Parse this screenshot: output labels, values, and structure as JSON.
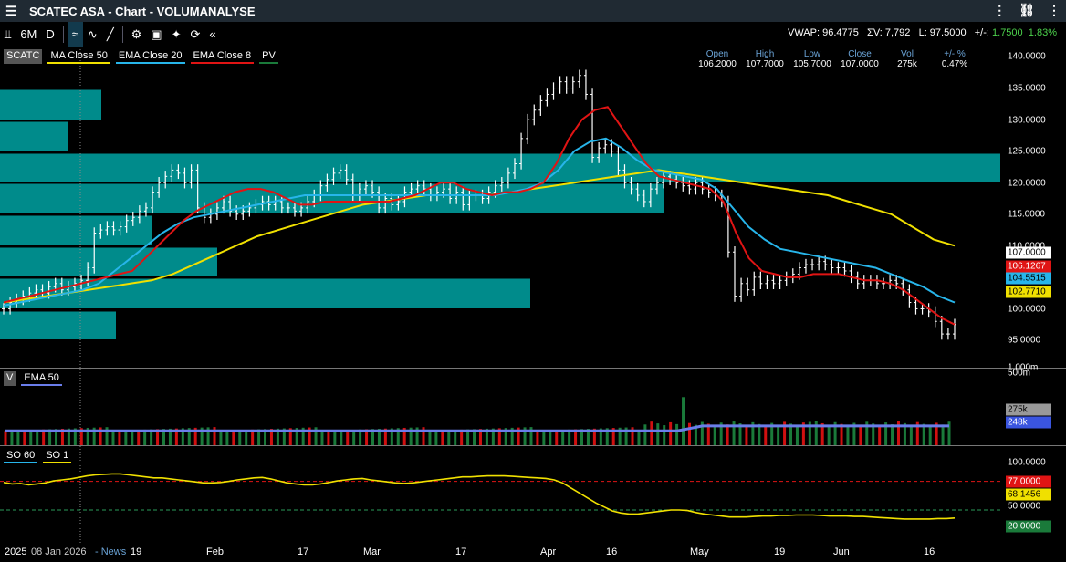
{
  "window": {
    "title": "SCATEC ASA - Chart - VOLUMANALYSE"
  },
  "toolbar": {
    "period": "6M",
    "interval": "D",
    "collapse": "«"
  },
  "quote": {
    "vwap": "VWAP: 96.4775",
    "volume": "ΣV: 7,792",
    "last": "L: 97.5000",
    "change_label": "+/-:",
    "change": "1.7500",
    "change_pct": "1.83%"
  },
  "legend": {
    "symbol": "SCATC",
    "ma50": "MA Close 50",
    "ema20": "EMA Close 20",
    "ema8": "EMA Close 8",
    "pv": "PV"
  },
  "ohlc": {
    "headers": [
      "Open",
      "High",
      "Low",
      "Close",
      "Vol",
      "+/- %"
    ],
    "values": [
      "106.2000",
      "107.7000",
      "105.7000",
      "107.0000",
      "275k",
      "0.47%"
    ]
  },
  "price_axis": {
    "ticks": [
      "140.0000",
      "135.0000",
      "130.0000",
      "125.0000",
      "120.0000",
      "115.0000",
      "110.0000",
      "100.0000",
      "95.0000"
    ],
    "tags": [
      {
        "label": "107.0000",
        "bg": "#ffffff",
        "fg": "#000000"
      },
      {
        "label": "106.1267",
        "bg": "#e01414",
        "fg": "#ffffff"
      },
      {
        "label": "104.5515",
        "bg": "#27b5ea",
        "fg": "#000000"
      },
      {
        "label": "102.7710",
        "bg": "#f0e000",
        "fg": "#000000"
      }
    ]
  },
  "volume_pane": {
    "legend_v": "V",
    "legend_ema": "EMA 50",
    "axis_top": "1.000m",
    "axis_mid": "500m",
    "tag_last": "275k",
    "tag_ema": "248k"
  },
  "so_pane": {
    "legend_60": "SO 60",
    "legend_1": "SO 1",
    "axis_100": "100.0000",
    "axis_50": "50.0000",
    "tag_77": "77.0000",
    "tag_68": "68.1456",
    "tag_20": "20.0000"
  },
  "xaxis": {
    "labels": [
      "2025",
      "08 Jan 2026",
      "- News",
      "19",
      "Feb",
      "17",
      "Mar",
      "17",
      "Apr",
      "16",
      "May",
      "19",
      "Jun",
      "16"
    ]
  },
  "colors": {
    "ema8": "#e01414",
    "ema20": "#27b5ea",
    "ma50": "#f0e000",
    "vp": "#008b8b",
    "vol_up": "#1a7a3a",
    "vol_down": "#d01010",
    "vol_ema": "#6a7dea"
  },
  "chart_data": {
    "type": "line",
    "price_closes": [
      100,
      101,
      101.5,
      102,
      102.5,
      103,
      102.5,
      103.5,
      104,
      103,
      103.5,
      104,
      104.5,
      106.5,
      112,
      112.5,
      113,
      112.5,
      113,
      114,
      114.5,
      115.5,
      116,
      118.5,
      120,
      121,
      122,
      121.5,
      120,
      122,
      116,
      114.5,
      115,
      116,
      117,
      115.5,
      115,
      115.5,
      116,
      116.5,
      117,
      116.5,
      117,
      116,
      116,
      115.5,
      116,
      117,
      118,
      119.5,
      120.5,
      121.5,
      122,
      120.5,
      118,
      119,
      119.5,
      118.5,
      116,
      117.5,
      116.5,
      117,
      118.5,
      119,
      119.5,
      119,
      118,
      118.5,
      119,
      117.5,
      118.5,
      116.5,
      118,
      118,
      117.5,
      118.5,
      119.5,
      120,
      121.5,
      123,
      127,
      130,
      131.5,
      133,
      134,
      135,
      136,
      135,
      136,
      137,
      134,
      124,
      125.5,
      126,
      125,
      122,
      120,
      119,
      118,
      117,
      119,
      120,
      121,
      120.5,
      120,
      119.5,
      119,
      120,
      119,
      118.5,
      118,
      117,
      109,
      102,
      104,
      103,
      105,
      104,
      104.5,
      104,
      104.5,
      105,
      105.5,
      106.5,
      107,
      107,
      107.5,
      107,
      106.5,
      106.5,
      106,
      105,
      104,
      104.5,
      104.5,
      104,
      104,
      104.5,
      104,
      103,
      101,
      100,
      100,
      99.5,
      98,
      96,
      96,
      97.5
    ],
    "ema8": [
      101,
      101.5,
      102,
      102.5,
      103,
      103.5,
      104,
      104.5,
      105,
      105.5,
      106,
      108,
      110,
      112,
      114,
      115.5,
      116.5,
      117.5,
      118.5,
      119,
      119,
      118.5,
      117.5,
      116.5,
      116.5,
      117,
      117,
      117,
      117,
      117,
      117,
      117.5,
      118,
      119,
      120,
      120,
      119,
      118.5,
      118,
      118.5,
      118.5,
      119,
      120,
      123,
      127,
      130,
      131.5,
      132,
      129,
      126,
      123,
      121,
      120.5,
      120,
      119.5,
      119,
      117,
      112,
      108,
      106,
      105.5,
      105,
      105,
      105.5,
      105.5,
      105.5,
      105,
      104.5,
      104.5,
      104,
      103,
      101.5,
      100,
      98.5,
      97.5
    ],
    "ema20": [
      100.5,
      101,
      101.5,
      102,
      102.5,
      103,
      104,
      106,
      108,
      110,
      112,
      113.5,
      114.5,
      115,
      115.5,
      116,
      116.5,
      117,
      117.5,
      118,
      118,
      118,
      118,
      118,
      118,
      118,
      118,
      118,
      118,
      118,
      118,
      118,
      118.5,
      119,
      120,
      122,
      125,
      126.5,
      127,
      125.5,
      123.5,
      122,
      121.5,
      121,
      120.5,
      119,
      116,
      113,
      111,
      109.5,
      109,
      108.5,
      108,
      107.5,
      107,
      106.5,
      105.5,
      104.5,
      103.5,
      102,
      101
    ],
    "ma50": [
      101,
      101.5,
      102,
      102.5,
      103,
      103.5,
      104,
      104.5,
      105.5,
      107,
      108.5,
      110,
      111.5,
      112.5,
      113.5,
      114.5,
      115.5,
      116.5,
      117,
      117.5,
      118,
      118,
      118,
      118,
      118.5,
      119,
      119.5,
      120,
      120.5,
      121,
      121.5,
      122,
      121.5,
      121,
      120.5,
      120,
      119.5,
      119,
      118.5,
      118,
      117,
      116,
      115,
      113,
      111,
      110
    ],
    "volume_pane": {
      "ema50": 248,
      "last": 275,
      "ylim": [
        0,
        1000
      ]
    },
    "so_pane": {
      "overbought": 77,
      "oversold": 20,
      "so60_last": 68.1456,
      "ylim": [
        0,
        100
      ]
    },
    "ylim": [
      93,
      141
    ]
  }
}
